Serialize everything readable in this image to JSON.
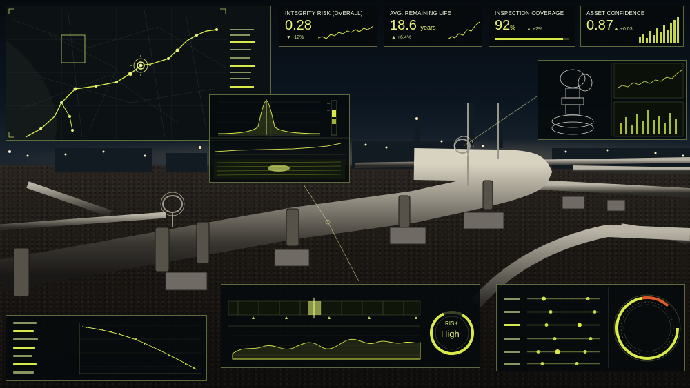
{
  "kpis": [
    {
      "title": "INTEGRITY RISK (OVERALL)",
      "value": "0.28",
      "unit": "",
      "delta": "▼ -12%"
    },
    {
      "title": "AVG. REMAINING LIFE",
      "value": "18.6",
      "unit": "years",
      "delta": "▲ +6.4%"
    },
    {
      "title": "INSPECTION COVERAGE",
      "value": "92",
      "unit": "%",
      "delta": "▲ +2%",
      "progress": 0.92
    },
    {
      "title": "ASSET CONFIDENCE",
      "value": "0.87",
      "unit": "",
      "delta": "▲ +0.03"
    }
  ],
  "risk": {
    "label": "RISK",
    "value": "High"
  },
  "colors": {
    "accent": "#d8ea4a",
    "accent_dim": "#8a9460",
    "panel_bg": "#060a0c",
    "alert": "#e05a2a"
  },
  "icons": [
    "target-reticle-icon",
    "valve-wheel-icon",
    "transmitter-device-icon"
  ]
}
